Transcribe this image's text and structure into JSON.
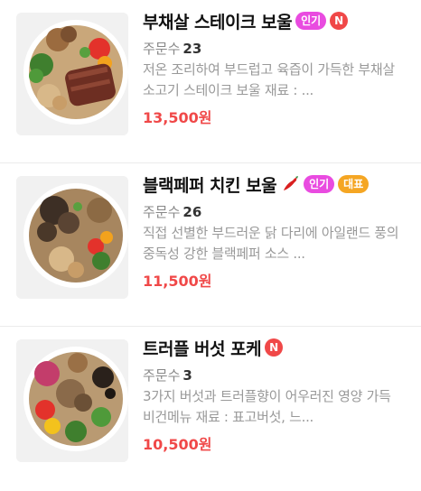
{
  "items": [
    {
      "title": "부채살 스테이크 보울",
      "badges": [
        "인기"
      ],
      "new_icon": "N",
      "order_label": "주문수",
      "order_count": "23",
      "description": "저온 조리하여 부드럽고 육즙이 가득한 부채살 소고기 스테이크 보울 재료 : ...",
      "price": "13,500원",
      "image": "beef-steak-bowl-photo"
    },
    {
      "title": "블랙페퍼 치킨 보울",
      "badges": [
        "인기",
        "대표"
      ],
      "spicy_icon": "chili-pepper-icon",
      "order_label": "주문수",
      "order_count": "26",
      "description": "직접 선별한 부드러운 닭 다리에 아일랜드 풍의 중독성 강한 블랙페퍼 소스 ...",
      "price": "11,500원",
      "image": "black-pepper-chicken-bowl-photo"
    },
    {
      "title": "트러플 버섯 포케",
      "new_icon": "N",
      "order_label": "주문수",
      "order_count": "3",
      "description": "3가지 버섯과 트러플향이 어우러진 영양 가득 비건메뉴 재료 : 표고버섯, 느...",
      "price": "10,500원",
      "image": "truffle-mushroom-poke-photo"
    }
  ],
  "colors": {
    "price": "#f04848",
    "badge_popular": "#e94be0",
    "badge_representative": "#f5a623",
    "new_icon": "#f04848"
  }
}
